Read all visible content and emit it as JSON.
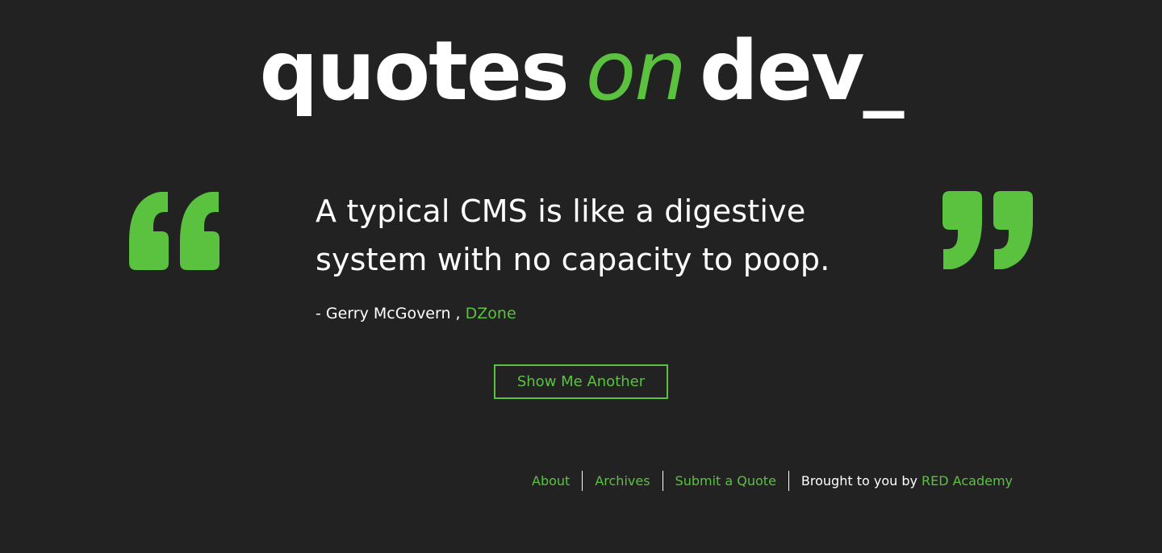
{
  "header": {
    "logo_part1": "quotes",
    "logo_part2": "on",
    "logo_part3": "dev_"
  },
  "quote": {
    "text": "A typical CMS is like a digestive system with no capacity to poop.",
    "author_prefix": "- Gerry McGovern ,",
    "source": "DZone"
  },
  "actions": {
    "show_another_label": "Show Me Another"
  },
  "footer": {
    "nav": [
      {
        "label": "About"
      },
      {
        "label": "Archives"
      },
      {
        "label": "Submit a Quote"
      }
    ],
    "credit_prefix": "Brought to you by",
    "credit_link": "RED Academy"
  },
  "icons": {
    "open_quote": "open-quote-icon",
    "close_quote": "close-quote-icon"
  },
  "colors": {
    "accent": "#5bc23f",
    "background": "#222222",
    "text": "#ffffff"
  }
}
